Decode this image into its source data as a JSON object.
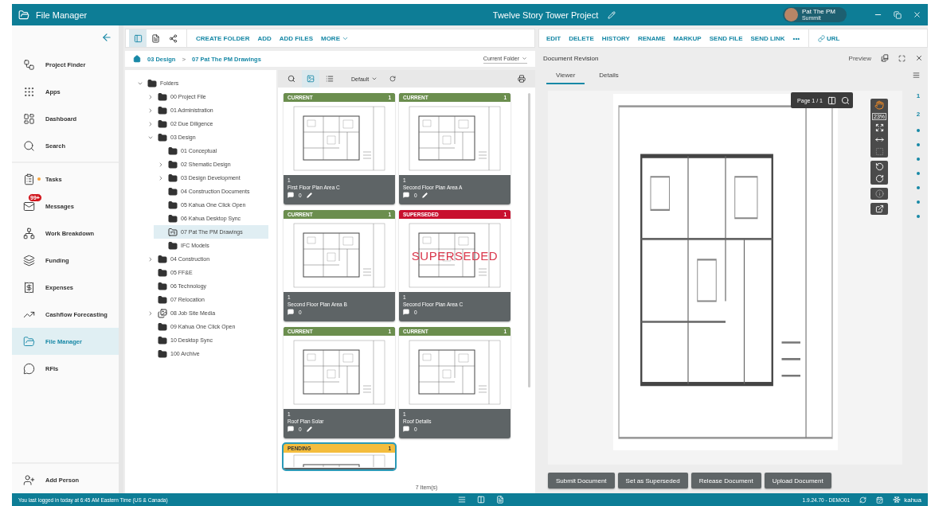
{
  "app_bar": {
    "title": "File Manager",
    "project": "Twelve Story Tower Project",
    "user": {
      "name": "Pat The PM",
      "org": "Summit"
    }
  },
  "sidebar": {
    "items": [
      {
        "label": "Project Finder",
        "selected": false,
        "dot": false
      },
      {
        "label": "Apps",
        "selected": false,
        "dot": false
      },
      {
        "label": "Dashboard",
        "selected": false,
        "dot": false
      },
      {
        "label": "Search",
        "selected": false,
        "dot": false
      },
      {
        "label": "Tasks",
        "selected": false,
        "dot": true
      },
      {
        "label": "Messages",
        "selected": false,
        "dot": false,
        "badge": "99+"
      },
      {
        "label": "Work Breakdown",
        "selected": false,
        "dot": false
      },
      {
        "label": "Funding",
        "selected": false,
        "dot": false
      },
      {
        "label": "Expenses",
        "selected": false,
        "dot": false
      },
      {
        "label": "Cashflow Forecasting",
        "selected": false,
        "dot": false
      },
      {
        "label": "File Manager",
        "selected": true,
        "dot": false
      },
      {
        "label": "RFIs",
        "selected": false,
        "dot": false
      }
    ],
    "footer": "Add Person"
  },
  "files_toolbar": {
    "view_buttons": [
      {
        "kind": "panel",
        "selected": true
      },
      {
        "kind": "document",
        "selected": false
      },
      {
        "kind": "share",
        "selected": false
      }
    ],
    "actions": [
      "CREATE FOLDER",
      "ADD",
      "ADD FILES"
    ],
    "more": "MORE"
  },
  "breadcrumb": {
    "path": [
      "03 Design",
      "07 Pat The PM Drawings"
    ],
    "separator": ">",
    "scope": "Current Folder"
  },
  "tree": {
    "root": {
      "label": "Folders",
      "kind": "folder",
      "selected": false,
      "expanded": true,
      "children": [
        {
          "label": "00 Project File",
          "kind": "folder",
          "selected": false,
          "expanded": false
        },
        {
          "label": "01 Administration",
          "kind": "folder",
          "selected": false,
          "expanded": false
        },
        {
          "label": "02 Due Diligence",
          "kind": "folder",
          "selected": false,
          "expanded": false
        },
        {
          "label": "03 Design",
          "kind": "folder",
          "selected": false,
          "expanded": true,
          "children": [
            {
              "label": "01 Conceptual",
              "kind": "folder",
              "selected": false
            },
            {
              "label": "02 Shematic Design",
              "kind": "folder",
              "selected": false,
              "expanded": false
            },
            {
              "label": "03 Design Development",
              "kind": "folder",
              "selected": false,
              "expanded": false
            },
            {
              "label": "04 Construction Documents",
              "kind": "folder",
              "selected": false
            },
            {
              "label": "05 Kahua One Click Open",
              "kind": "folder",
              "selected": false
            },
            {
              "label": "06 Kahua Desktop Sync",
              "kind": "folder",
              "selected": false
            },
            {
              "label": "07 Pat The PM Drawings",
              "kind": "drawings",
              "selected": true
            },
            {
              "label": "IFC Models",
              "kind": "folder",
              "selected": false
            }
          ]
        },
        {
          "label": "04 Construction",
          "kind": "folder",
          "selected": false,
          "expanded": false
        },
        {
          "label": "05 FF&E",
          "kind": "folder",
          "selected": false
        },
        {
          "label": "06 Technology",
          "kind": "folder",
          "selected": false
        },
        {
          "label": "07 Relocation",
          "kind": "folder",
          "selected": false
        },
        {
          "label": "08 Job Site Media",
          "kind": "media",
          "selected": false,
          "expanded": false
        },
        {
          "label": "09 Kahua One Click Open",
          "kind": "folder",
          "selected": false
        },
        {
          "label": "10 Desktop Sync",
          "kind": "folder",
          "selected": false
        },
        {
          "label": "100  Archive",
          "kind": "folder",
          "selected": false
        }
      ]
    }
  },
  "gallery": {
    "views": [
      {
        "kind": "grid",
        "selected": true
      },
      {
        "kind": "list",
        "selected": false
      }
    ],
    "sort": "Default",
    "cards": [
      {
        "kind": "current",
        "status": "CURRENT",
        "count": "1",
        "version": "1",
        "title": "First Floor Plan Area C",
        "comments": "0",
        "editable": true,
        "selected": false
      },
      {
        "kind": "current",
        "status": "CURRENT",
        "count": "1",
        "version": "1",
        "title": "Second Floor Plan Area A",
        "comments": "0",
        "editable": true,
        "selected": false
      },
      {
        "kind": "current",
        "status": "CURRENT",
        "count": "1",
        "version": "1",
        "title": "Second Floor Plan Area B",
        "comments": "0",
        "editable": false,
        "selected": false
      },
      {
        "kind": "superseded",
        "status": "SUPERSEDED",
        "count": "1",
        "version": "1",
        "title": "Second Floor Plan Area C",
        "comments": "0",
        "editable": false,
        "selected": false,
        "watermark": "SUPERSEDED"
      },
      {
        "kind": "current",
        "status": "CURRENT",
        "count": "1",
        "version": "1",
        "title": "Roof Plan Solar",
        "comments": "0",
        "editable": true,
        "selected": false
      },
      {
        "kind": "current",
        "status": "CURRENT",
        "count": "1",
        "version": "1",
        "title": "Roof Details",
        "comments": "0",
        "editable": false,
        "selected": false
      },
      {
        "kind": "pending",
        "status": "PENDING",
        "count": "1",
        "selected": true
      }
    ],
    "count": "7 Item(s)"
  },
  "document_toolbar": {
    "actions": [
      "EDIT",
      "DELETE",
      "HISTORY",
      "RENAME",
      "MARKUP",
      "SEND FILE",
      "SEND LINK"
    ],
    "overflow": "•••",
    "url": "URL"
  },
  "document": {
    "title": "Document Revision",
    "preview": "Preview",
    "tabs": [
      {
        "label": "Viewer",
        "selected": true
      },
      {
        "label": "Details",
        "selected": false
      }
    ],
    "viewer": {
      "page": "Page 1 / 1",
      "zoom": "23%"
    },
    "pages": [
      "1",
      "2"
    ],
    "buttons": [
      "Submit Document",
      "Set as Superseded",
      "Release Document",
      "Upload Document"
    ]
  },
  "status_bar": {
    "message": "You last logged in today at 6:45 AM Eastern Time (US & Canada)",
    "version": "1.9.24.70 - DEMO01",
    "brand": "kahua"
  }
}
